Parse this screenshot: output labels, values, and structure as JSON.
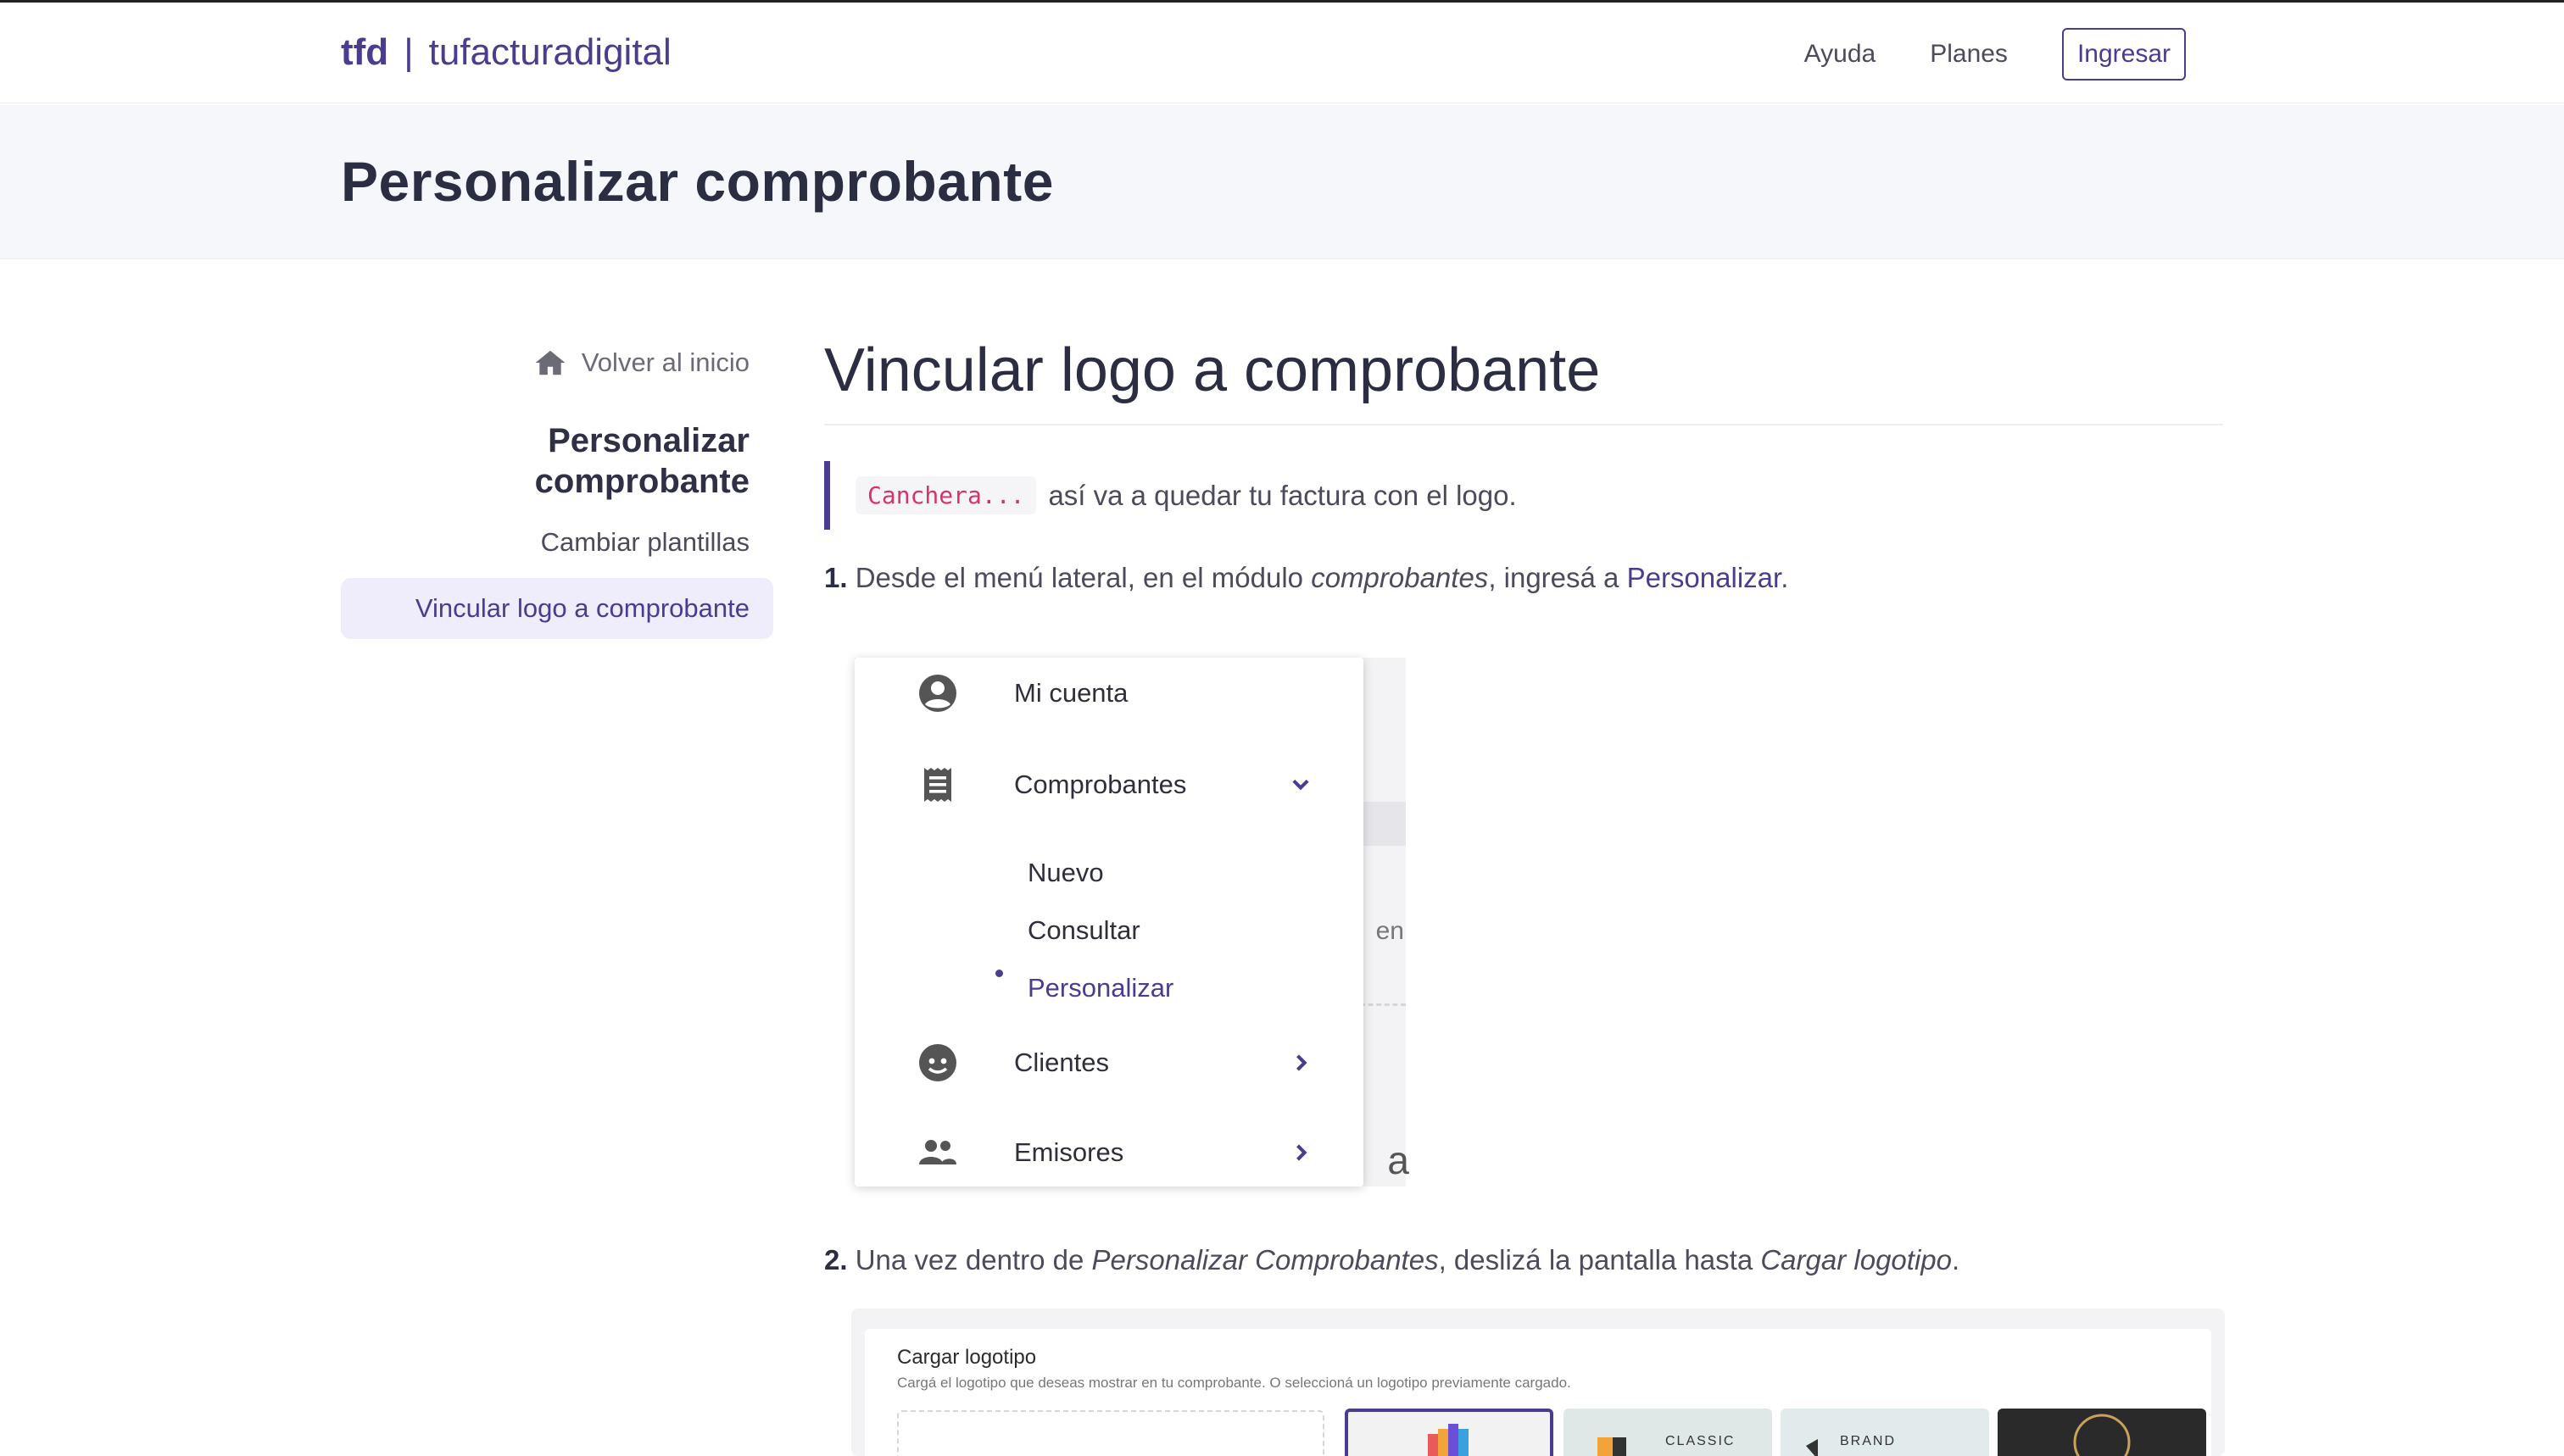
{
  "header": {
    "brand_short": "tfd",
    "brand_sep": "|",
    "brand_long": "tufacturadigital",
    "nav": {
      "help": "Ayuda",
      "plans": "Planes",
      "login": "Ingresar"
    }
  },
  "hero": {
    "title": "Personalizar comprobante"
  },
  "sidebar": {
    "back": "Volver al inicio",
    "section_line1": "Personalizar",
    "section_line2": "comprobante",
    "items": [
      {
        "label": "Cambiar plantillas"
      },
      {
        "label": "Vincular logo a comprobante"
      }
    ]
  },
  "main": {
    "title": "Vincular logo a comprobante",
    "quote_code": "Canchera...",
    "quote_text": "así va a quedar tu factura con el logo.",
    "step1": {
      "num": "1.",
      "text_a": "Desde el menú lateral, en el módulo",
      "text_em": "comprobantes",
      "text_b": ", ingresá a",
      "link": "Personalizar",
      "text_c": "."
    },
    "step2": {
      "num": "2.",
      "text_a": "Una vez dentro de",
      "text_em1": "Personalizar Comprobantes",
      "text_b": ", deslizá la pantalla hasta",
      "text_em2": "Cargar logotipo",
      "text_c": "."
    }
  },
  "menu_screenshot": {
    "items": [
      {
        "label": "Mi cuenta",
        "icon": "account-circle-icon"
      },
      {
        "label": "Comprobantes",
        "icon": "receipt-icon"
      },
      {
        "label": "Clientes",
        "icon": "face-icon"
      },
      {
        "label": "Emisores",
        "icon": "people-icon"
      }
    ],
    "sub_items": [
      {
        "label": "Nuevo"
      },
      {
        "label": "Consultar"
      },
      {
        "label": "Personalizar"
      }
    ],
    "bg_text": "en",
    "bg_big": "a"
  },
  "logo_screenshot": {
    "title": "Cargar logotipo",
    "desc": "Cargá el logotipo que deseas mostrar en tu comprobante. O seleccioná un logotipo previamente cargado.",
    "thumb_classic": "CLASSIC",
    "thumb_brand": "BRAND"
  },
  "colors": {
    "accent": "#4a3c8f",
    "code": "#d6336c",
    "hero_bg": "#f6f7fb"
  }
}
